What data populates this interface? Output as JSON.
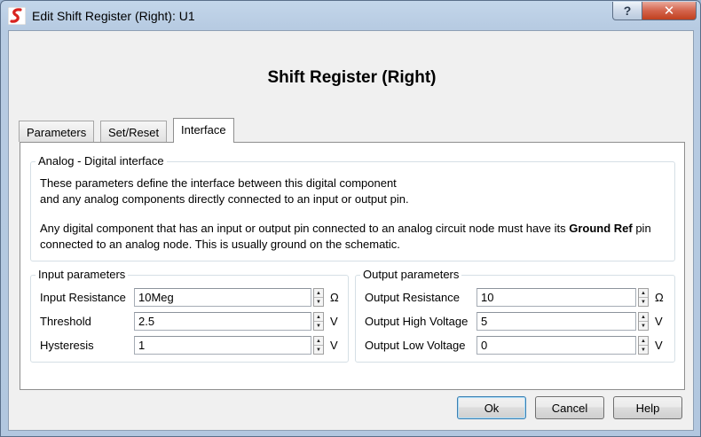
{
  "window": {
    "title": "Edit Shift Register (Right): U1",
    "help_glyph": "?",
    "close_glyph": "✕",
    "app_icon": "simetrix-logo-icon"
  },
  "dialog": {
    "heading": "Shift Register (Right)",
    "tabs": [
      {
        "label": "Parameters",
        "active": false
      },
      {
        "label": "Set/Reset",
        "active": false
      },
      {
        "label": "Interface",
        "active": true
      }
    ]
  },
  "interface": {
    "group_title": "Analog - Digital interface",
    "para1_line1": "These parameters define the interface between this digital component",
    "para1_line2": "and any analog components directly connected to an input or output pin.",
    "para2_line1_before": "Any digital component that has an input or output pin connected to an analog circuit node must have its ",
    "para2_bold": "Ground Ref",
    "para2_line1_after": " pin",
    "para2_line2": "connected to an analog node. This is usually ground on the schematic."
  },
  "input_params": {
    "group_title": "Input parameters",
    "rows": [
      {
        "label": "Input Resistance",
        "value": "10Meg",
        "unit": "Ω"
      },
      {
        "label": "Threshold",
        "value": "2.5",
        "unit": "V"
      },
      {
        "label": "Hysteresis",
        "value": "1",
        "unit": "V"
      }
    ]
  },
  "output_params": {
    "group_title": "Output parameters",
    "rows": [
      {
        "label": "Output Resistance",
        "value": "10",
        "unit": "Ω"
      },
      {
        "label": "Output High Voltage",
        "value": "5",
        "unit": "V"
      },
      {
        "label": "Output Low Voltage",
        "value": "0",
        "unit": "V"
      }
    ]
  },
  "buttons": {
    "ok": "Ok",
    "cancel": "Cancel",
    "help": "Help"
  },
  "colors": {
    "title_bar": "#b7cbe2",
    "close_button": "#c7472b",
    "default_button_border": "#3c7fb1",
    "logo_red": "#d8231f"
  }
}
